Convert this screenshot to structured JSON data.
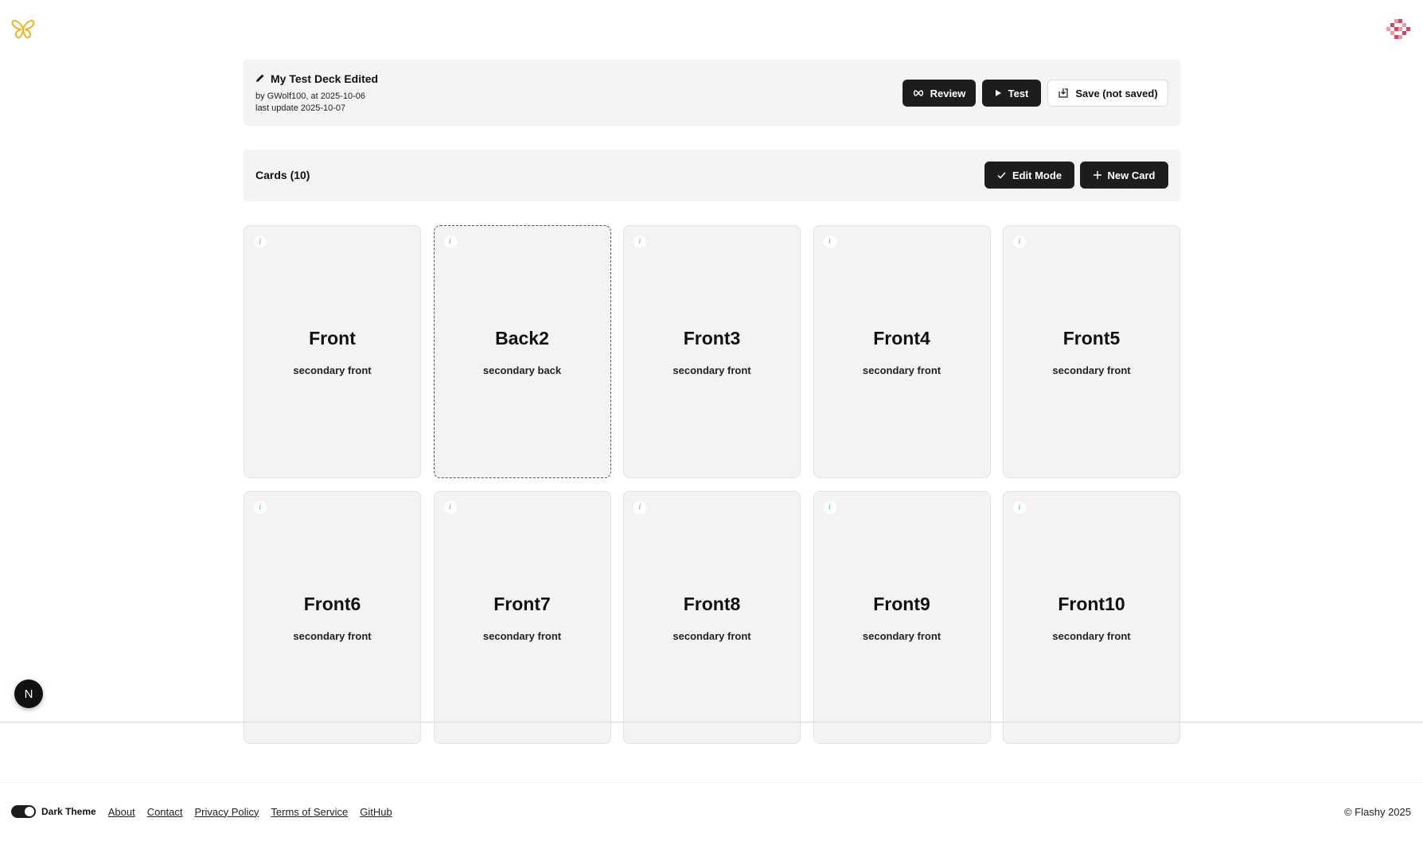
{
  "header": {
    "logo_icon": "butterfly-icon",
    "avatar_icon": "pixel-avatar-icon"
  },
  "deck": {
    "title": "My Test Deck Edited",
    "author_line": "by GWolf100, at 2025-10-06",
    "update_line": "last update 2025-10-07",
    "review_label": "Review",
    "test_label": "Test",
    "save_label": "Save (not saved)"
  },
  "cards_section": {
    "title": "Cards (10)",
    "edit_mode_label": "Edit Mode",
    "new_card_label": "New Card"
  },
  "cards": [
    {
      "primary": "Front",
      "secondary": "secondary front",
      "info": "i"
    },
    {
      "primary": "Back2",
      "secondary": "secondary back",
      "info": "i"
    },
    {
      "primary": "Front3",
      "secondary": "secondary front",
      "info": "i"
    },
    {
      "primary": "Front4",
      "secondary": "secondary front",
      "info": "i"
    },
    {
      "primary": "Front5",
      "secondary": "secondary front",
      "info": "i"
    },
    {
      "primary": "Front6",
      "secondary": "secondary front",
      "info": "i"
    },
    {
      "primary": "Front7",
      "secondary": "secondary front",
      "info": "i"
    },
    {
      "primary": "Front8",
      "secondary": "secondary front",
      "info": "i"
    },
    {
      "primary": "Front9",
      "secondary": "secondary front",
      "info": "i"
    },
    {
      "primary": "Front10",
      "secondary": "secondary front",
      "info": "i"
    }
  ],
  "n_badge": "N",
  "footer": {
    "theme_label": "Dark Theme",
    "links": [
      "About",
      "Contact",
      "Privacy Policy",
      "Terms of Service",
      "GitHub"
    ],
    "copyright": "© Flashy 2025"
  },
  "colors": {
    "accent_logo": "#f0b429",
    "button_dark": "#1d1d1d",
    "panel_bg": "#f4f4f4",
    "info_icon": "#4db6ac"
  }
}
